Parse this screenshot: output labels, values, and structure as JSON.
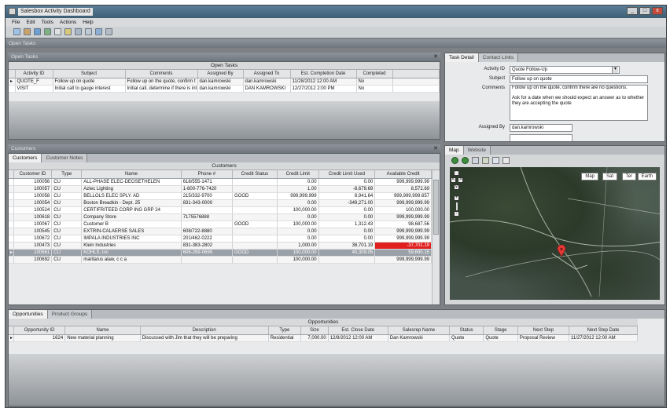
{
  "window": {
    "title": "Salesbox Activity Dashboard",
    "min": "_",
    "max": "□",
    "close": "x"
  },
  "menu": [
    "File",
    "Edit",
    "Tools",
    "Actions",
    "Help"
  ],
  "layout_title": "Open Tasks",
  "open_tasks": {
    "bar_title": "Open Tasks",
    "caption": "Open Tasks",
    "columns": [
      "Activity ID",
      "Subject",
      "Comments",
      "Assigned By",
      "Assigned To",
      "Est. Completion Date",
      "Completed"
    ],
    "rows": [
      [
        "QUOTE_F",
        "Follow up on quote",
        "Follow up on the quote, confirm t",
        "dan.kamrowski",
        "dan.kamrowski",
        "11/28/2012 12:00 AM",
        "No"
      ],
      [
        "VISIT",
        "Initial call to gauge interest",
        "Initial call, determine if there is int",
        "dan.kamrowski",
        "DAN KAMROWSKI",
        "12/27/2012 2:00 PM",
        "No"
      ]
    ]
  },
  "customers": {
    "bar_title": "Customers",
    "tabs": [
      "Customers",
      "Customer Notes"
    ],
    "caption": "Customers",
    "columns": [
      "Customer ID",
      "Type",
      "Name",
      "Phone #",
      "Credit Status",
      "Credit Limit",
      "Credit Limit Used",
      "Available Credit"
    ],
    "rows": [
      [
        "100056",
        "CU",
        "ALL-PHASE ELEC-DEOSETHELEN",
        "618/555-1471",
        "",
        "0.00",
        "0.00",
        "999,999,999.99"
      ],
      [
        "100057",
        "CU",
        "Aztec Lighting",
        "1-800-776-7420",
        "",
        "1.00",
        "-8,679.69",
        "8,572.69"
      ],
      [
        "100058",
        "CU",
        "BELLOLS ELEC SPLY. AD",
        "215/332-9700",
        "GOOD",
        "999,999.999",
        "8,941.64",
        "999,999,999.657"
      ],
      [
        "100054",
        "CU",
        "Boston Breadkin - Dept. 25",
        "831-343-0000",
        "",
        "0.00",
        "-349,271.00",
        "999,999,999.99"
      ],
      [
        "100524",
        "CU",
        "CERTIFRITEED CORP ING GRP 24",
        "",
        "",
        "100,000.00",
        "0.00",
        "100,000.00"
      ],
      [
        "100618",
        "CU",
        "Company Store",
        "7175576888",
        "",
        "0.00",
        "0.00",
        "999,999,999.99"
      ],
      [
        "100067",
        "CU",
        "Customer B",
        "",
        "GOOD",
        "100,000.00",
        "1,312.43",
        "98,687.56"
      ],
      [
        "100545",
        "CU",
        "EXTRIN-CALAERSE SALES",
        "608/722-8880",
        "",
        "0.00",
        "0.00",
        "999,999,999.99"
      ],
      [
        "100672",
        "CU",
        "IMPALA INDUSTRIES INC",
        "201/462-0222",
        "",
        "0.00",
        "0.00",
        "999,999,999.99"
      ],
      [
        "100473",
        "CU",
        "Klein Industries",
        "831-383-2802",
        "",
        "1,000.00",
        "38,701.19",
        "-37,701.19"
      ],
      [
        "100661",
        "CU",
        "KOHLS, Inc",
        "608-299-0699",
        "GOOD",
        "100,000.00",
        "40,309.05",
        "59,690.15"
      ],
      [
        "100692",
        "CU",
        "maritarus alaw, c c a",
        "",
        "",
        "100,000.00",
        "",
        "999,999,999.99"
      ]
    ]
  },
  "opportunities": {
    "tabs": [
      "Opportunities",
      "Product Groups"
    ],
    "caption": "Opportunities",
    "columns": [
      "Opportunity ID",
      "Name",
      "Description",
      "Type",
      "Size",
      "Est. Close Date",
      "Salesrep Name",
      "Status",
      "Stage",
      "Next Step",
      "Next Step Date"
    ],
    "rows": [
      [
        "1624",
        "New material planning",
        "Discussed with Jim that they will be preparing",
        "Residential",
        "7,000.00",
        "12/8/2012 12:00 AM",
        "Dan Kamrowski",
        "Quote",
        "Quote",
        "Proposal Review",
        "11/27/2012 12:00 AM"
      ]
    ]
  },
  "task_detail": {
    "tabs": [
      "Task Detail",
      "Contact Links"
    ],
    "activity_id_label": "Activity ID",
    "activity_id_value": "Quote Follow-Up",
    "subject_label": "Subject",
    "subject_value": "Follow up on quote",
    "comments_label": "Comments",
    "comments_value": "Follow up on the quote, confirm there are no questions.",
    "comments_value_2": "Ask for a date when we should expect an answer as to whether they are accepting the quote",
    "assigned_by_label": "Assigned By",
    "assigned_by_value": "dan.kamrowski"
  },
  "map": {
    "tabs": [
      "Map",
      "Website"
    ],
    "buttons": [
      "Map",
      "Sat",
      "Ter",
      "Earth"
    ],
    "marker_color": "#e53935"
  }
}
